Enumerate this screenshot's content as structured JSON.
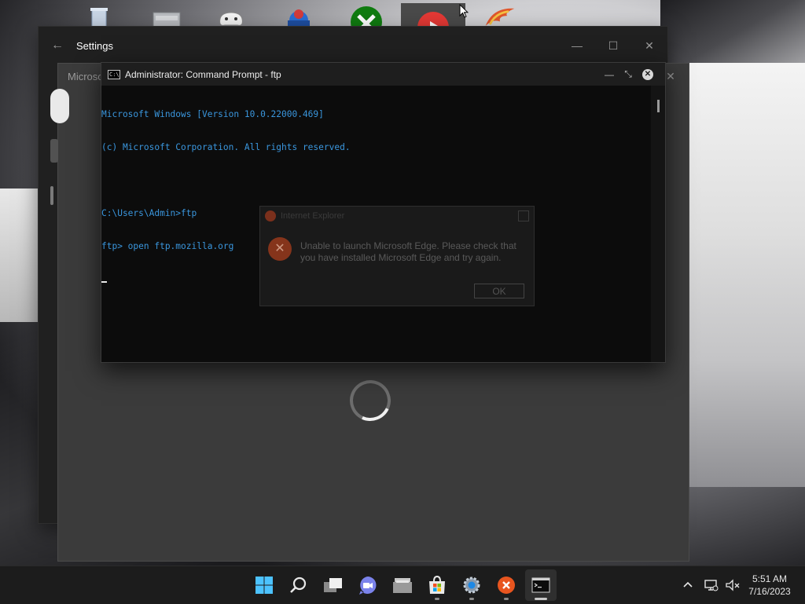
{
  "desktop": {
    "icons": [
      "recycle-bin",
      "file-cabinet",
      "game-controller",
      "joystick-app",
      "xbox",
      "youtube",
      "phoenix-app"
    ]
  },
  "settings_window": {
    "title": "Settings",
    "back_glyph": "←",
    "min_glyph": "—",
    "max_glyph": "☐",
    "close_glyph": "✕"
  },
  "store_window": {
    "title": "Microso",
    "close_glyph": "✕"
  },
  "cmd_window": {
    "title": "Administrator: Command Prompt - ftp",
    "icon_text": "C:\\",
    "min_glyph": "—",
    "restore_glyph": "⤡",
    "close_glyph": "✕",
    "lines": [
      "Microsoft Windows [Version 10.0.22000.469]",
      "(c) Microsoft Corporation. All rights reserved.",
      "",
      "C:\\Users\\Admin>ftp",
      "ftp> open ftp.mozilla.org"
    ]
  },
  "error_dialog": {
    "title": "Internet Explorer",
    "message": "Unable to launch Microsoft Edge. Please check that you have installed Microsoft Edge and try again.",
    "ok_label": "OK",
    "icon_glyph": "✕"
  },
  "taskbar": {
    "apps": [
      {
        "name": "start",
        "active": false,
        "running": false
      },
      {
        "name": "search",
        "active": false,
        "running": false
      },
      {
        "name": "task-view",
        "active": false,
        "running": false
      },
      {
        "name": "chat",
        "active": false,
        "running": false
      },
      {
        "name": "file-explorer",
        "active": false,
        "running": false
      },
      {
        "name": "microsoft-store",
        "active": false,
        "running": true
      },
      {
        "name": "settings",
        "active": false,
        "running": true
      },
      {
        "name": "error-app",
        "active": false,
        "running": true
      },
      {
        "name": "command-prompt",
        "active": true,
        "running": true
      }
    ],
    "tray": {
      "chevron_glyph": "^",
      "time": "5:51 AM",
      "date": "7/16/2023"
    }
  },
  "colors": {
    "cmd_text": "#3a96dd",
    "accent": "#0078d4",
    "error": "#de4a1e"
  }
}
